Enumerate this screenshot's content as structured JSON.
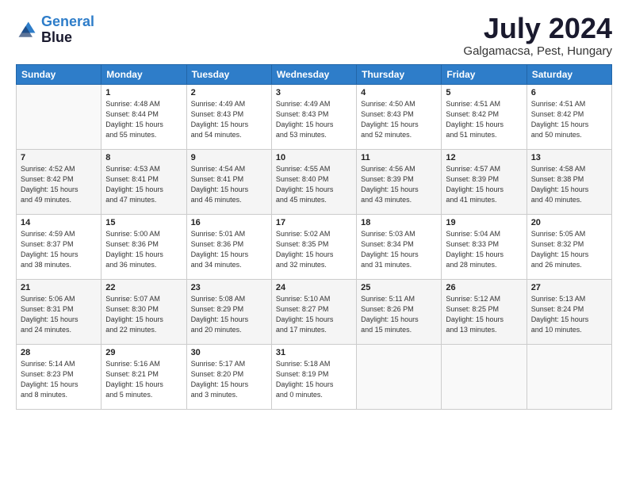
{
  "logo": {
    "line1": "General",
    "line2": "Blue"
  },
  "title": "July 2024",
  "location": "Galgamacsa, Pest, Hungary",
  "headers": [
    "Sunday",
    "Monday",
    "Tuesday",
    "Wednesday",
    "Thursday",
    "Friday",
    "Saturday"
  ],
  "weeks": [
    [
      {
        "day": "",
        "info": ""
      },
      {
        "day": "1",
        "info": "Sunrise: 4:48 AM\nSunset: 8:44 PM\nDaylight: 15 hours\nand 55 minutes."
      },
      {
        "day": "2",
        "info": "Sunrise: 4:49 AM\nSunset: 8:43 PM\nDaylight: 15 hours\nand 54 minutes."
      },
      {
        "day": "3",
        "info": "Sunrise: 4:49 AM\nSunset: 8:43 PM\nDaylight: 15 hours\nand 53 minutes."
      },
      {
        "day": "4",
        "info": "Sunrise: 4:50 AM\nSunset: 8:43 PM\nDaylight: 15 hours\nand 52 minutes."
      },
      {
        "day": "5",
        "info": "Sunrise: 4:51 AM\nSunset: 8:42 PM\nDaylight: 15 hours\nand 51 minutes."
      },
      {
        "day": "6",
        "info": "Sunrise: 4:51 AM\nSunset: 8:42 PM\nDaylight: 15 hours\nand 50 minutes."
      }
    ],
    [
      {
        "day": "7",
        "info": "Sunrise: 4:52 AM\nSunset: 8:42 PM\nDaylight: 15 hours\nand 49 minutes."
      },
      {
        "day": "8",
        "info": "Sunrise: 4:53 AM\nSunset: 8:41 PM\nDaylight: 15 hours\nand 47 minutes."
      },
      {
        "day": "9",
        "info": "Sunrise: 4:54 AM\nSunset: 8:41 PM\nDaylight: 15 hours\nand 46 minutes."
      },
      {
        "day": "10",
        "info": "Sunrise: 4:55 AM\nSunset: 8:40 PM\nDaylight: 15 hours\nand 45 minutes."
      },
      {
        "day": "11",
        "info": "Sunrise: 4:56 AM\nSunset: 8:39 PM\nDaylight: 15 hours\nand 43 minutes."
      },
      {
        "day": "12",
        "info": "Sunrise: 4:57 AM\nSunset: 8:39 PM\nDaylight: 15 hours\nand 41 minutes."
      },
      {
        "day": "13",
        "info": "Sunrise: 4:58 AM\nSunset: 8:38 PM\nDaylight: 15 hours\nand 40 minutes."
      }
    ],
    [
      {
        "day": "14",
        "info": "Sunrise: 4:59 AM\nSunset: 8:37 PM\nDaylight: 15 hours\nand 38 minutes."
      },
      {
        "day": "15",
        "info": "Sunrise: 5:00 AM\nSunset: 8:36 PM\nDaylight: 15 hours\nand 36 minutes."
      },
      {
        "day": "16",
        "info": "Sunrise: 5:01 AM\nSunset: 8:36 PM\nDaylight: 15 hours\nand 34 minutes."
      },
      {
        "day": "17",
        "info": "Sunrise: 5:02 AM\nSunset: 8:35 PM\nDaylight: 15 hours\nand 32 minutes."
      },
      {
        "day": "18",
        "info": "Sunrise: 5:03 AM\nSunset: 8:34 PM\nDaylight: 15 hours\nand 31 minutes."
      },
      {
        "day": "19",
        "info": "Sunrise: 5:04 AM\nSunset: 8:33 PM\nDaylight: 15 hours\nand 28 minutes."
      },
      {
        "day": "20",
        "info": "Sunrise: 5:05 AM\nSunset: 8:32 PM\nDaylight: 15 hours\nand 26 minutes."
      }
    ],
    [
      {
        "day": "21",
        "info": "Sunrise: 5:06 AM\nSunset: 8:31 PM\nDaylight: 15 hours\nand 24 minutes."
      },
      {
        "day": "22",
        "info": "Sunrise: 5:07 AM\nSunset: 8:30 PM\nDaylight: 15 hours\nand 22 minutes."
      },
      {
        "day": "23",
        "info": "Sunrise: 5:08 AM\nSunset: 8:29 PM\nDaylight: 15 hours\nand 20 minutes."
      },
      {
        "day": "24",
        "info": "Sunrise: 5:10 AM\nSunset: 8:27 PM\nDaylight: 15 hours\nand 17 minutes."
      },
      {
        "day": "25",
        "info": "Sunrise: 5:11 AM\nSunset: 8:26 PM\nDaylight: 15 hours\nand 15 minutes."
      },
      {
        "day": "26",
        "info": "Sunrise: 5:12 AM\nSunset: 8:25 PM\nDaylight: 15 hours\nand 13 minutes."
      },
      {
        "day": "27",
        "info": "Sunrise: 5:13 AM\nSunset: 8:24 PM\nDaylight: 15 hours\nand 10 minutes."
      }
    ],
    [
      {
        "day": "28",
        "info": "Sunrise: 5:14 AM\nSunset: 8:23 PM\nDaylight: 15 hours\nand 8 minutes."
      },
      {
        "day": "29",
        "info": "Sunrise: 5:16 AM\nSunset: 8:21 PM\nDaylight: 15 hours\nand 5 minutes."
      },
      {
        "day": "30",
        "info": "Sunrise: 5:17 AM\nSunset: 8:20 PM\nDaylight: 15 hours\nand 3 minutes."
      },
      {
        "day": "31",
        "info": "Sunrise: 5:18 AM\nSunset: 8:19 PM\nDaylight: 15 hours\nand 0 minutes."
      },
      {
        "day": "",
        "info": ""
      },
      {
        "day": "",
        "info": ""
      },
      {
        "day": "",
        "info": ""
      }
    ]
  ]
}
